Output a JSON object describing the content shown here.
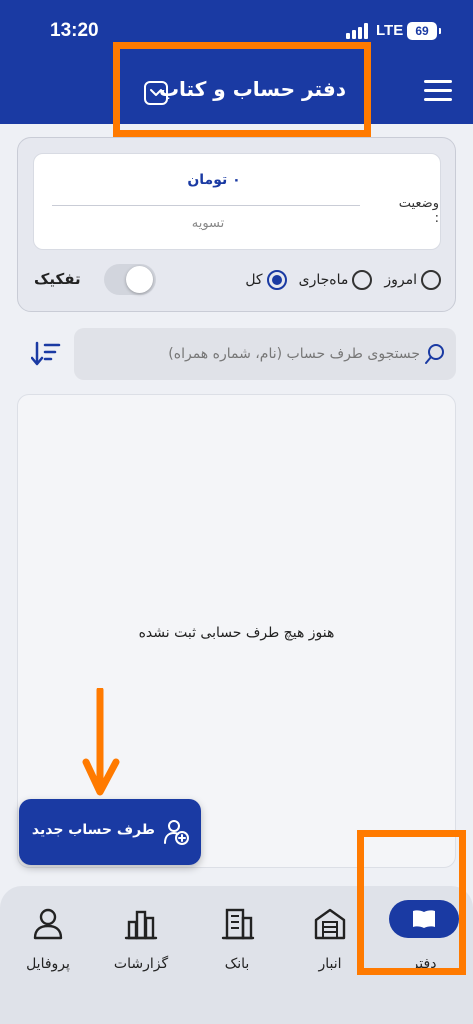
{
  "status_bar": {
    "time": "13:20",
    "network": "LTE",
    "battery": "69"
  },
  "header": {
    "title": "دفتر حساب و کتاب",
    "dropdown_icon": "chevron-down-icon",
    "menu_icon": "hamburger-menu-icon"
  },
  "balance": {
    "status_label": "وضعیت :",
    "amount": "۰ تومان",
    "state": "تسویه"
  },
  "filters": {
    "options": [
      {
        "label": "امروز",
        "selected": false
      },
      {
        "label": "ماه‌جاری",
        "selected": false
      },
      {
        "label": "کل",
        "selected": true
      }
    ],
    "split_label": "تفکیک",
    "split_on": false
  },
  "search": {
    "placeholder": "جستجوی طرف حساب (نام، شماره همراه)",
    "value": ""
  },
  "list": {
    "empty_message": "هنوز هیچ طرف حسابی ثبت نشده"
  },
  "fab": {
    "label": "طرف حساب جدید"
  },
  "nav": {
    "items": [
      {
        "label": "دفتر",
        "icon": "book-icon",
        "active": true
      },
      {
        "label": "انبار",
        "icon": "warehouse-icon",
        "active": false
      },
      {
        "label": "بانک",
        "icon": "bank-icon",
        "active": false
      },
      {
        "label": "گزارشات",
        "icon": "reports-icon",
        "active": false
      },
      {
        "label": "پروفایل",
        "icon": "profile-icon",
        "active": false
      }
    ]
  },
  "colors": {
    "primary": "#1a3aa3",
    "annotation": "#ff7a00"
  }
}
